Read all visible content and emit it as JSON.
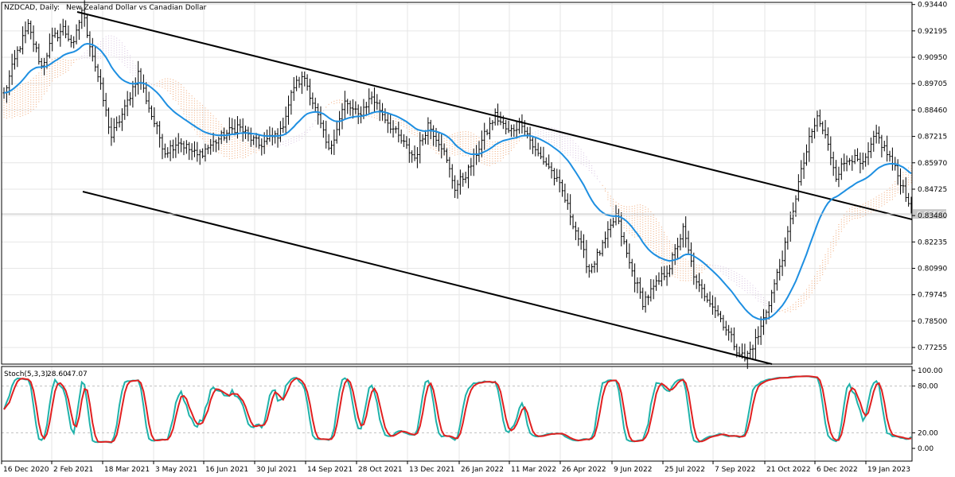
{
  "header": {
    "symbol": "NZDCAD, Daily:",
    "description": "New Zealand Dollar vs Canadian Dollar"
  },
  "stoch_header": {
    "label": "Stoch(5,3,3)",
    "main": "28.60",
    "signal": "47.07"
  },
  "colors": {
    "background": "#ffffff",
    "grid": "#e6e6e6",
    "bars": "#000000",
    "ma": "#1e8fe1",
    "cloud_bullish": "#f0a878",
    "cloud_bearish": "#d8c4e0",
    "channel": "#000000",
    "current_price_line": "#c0c0c0",
    "current_price_box": "#c8c8c8",
    "stoch_main": "#20b2aa",
    "stoch_signal": "#e02020",
    "stoch_levels": "#c0c0c0"
  },
  "chart_data": [
    {
      "type": "line",
      "panel": "price",
      "title": "NZDCAD, Daily: New Zealand Dollar vs Canadian Dollar",
      "x_labels": [
        "16 Dec 2020",
        "2 Feb 2021",
        "18 Mar 2021",
        "3 May 2021",
        "16 Jun 2021",
        "30 Jul 2021",
        "14 Sep 2021",
        "28 Oct 2021",
        "13 Dec 2021",
        "26 Jan 2022",
        "11 Mar 2022",
        "26 Apr 2022",
        "9 Jun 2022",
        "25 Jul 2022",
        "7 Sep 2022",
        "21 Oct 2022",
        "6 Dec 2022",
        "19 Jan 2023"
      ],
      "y_ticks": [
        "0.93440",
        "0.92195",
        "0.90950",
        "0.89705",
        "0.88460",
        "0.87215",
        "0.85970",
        "0.84725",
        "0.83480",
        "0.82235",
        "0.80990",
        "0.79745",
        "0.78500",
        "0.77255"
      ],
      "ylim": [
        0.7647,
        0.9354
      ],
      "current_price": "0.83556",
      "price_path": [
        [
          0,
          0.892
        ],
        [
          5,
          0.912
        ],
        [
          9,
          0.924
        ],
        [
          14,
          0.905
        ],
        [
          18,
          0.918
        ],
        [
          22,
          0.923
        ],
        [
          26,
          0.915
        ],
        [
          29,
          0.932
        ],
        [
          32,
          0.916
        ],
        [
          36,
          0.895
        ],
        [
          40,
          0.872
        ],
        [
          45,
          0.885
        ],
        [
          50,
          0.902
        ],
        [
          55,
          0.882
        ],
        [
          60,
          0.865
        ],
        [
          65,
          0.87
        ],
        [
          72,
          0.863
        ],
        [
          80,
          0.871
        ],
        [
          87,
          0.877
        ],
        [
          95,
          0.868
        ],
        [
          103,
          0.874
        ],
        [
          108,
          0.896
        ],
        [
          112,
          0.9
        ],
        [
          117,
          0.881
        ],
        [
          121,
          0.865
        ],
        [
          127,
          0.888
        ],
        [
          132,
          0.882
        ],
        [
          137,
          0.891
        ],
        [
          142,
          0.881
        ],
        [
          148,
          0.87
        ],
        [
          153,
          0.862
        ],
        [
          158,
          0.878
        ],
        [
          163,
          0.868
        ],
        [
          168,
          0.848
        ],
        [
          173,
          0.856
        ],
        [
          178,
          0.87
        ],
        [
          183,
          0.882
        ],
        [
          188,
          0.874
        ],
        [
          193,
          0.879
        ],
        [
          198,
          0.865
        ],
        [
          203,
          0.858
        ],
        [
          208,
          0.846
        ],
        [
          213,
          0.828
        ],
        [
          218,
          0.809
        ],
        [
          223,
          0.82
        ],
        [
          228,
          0.835
        ],
        [
          233,
          0.812
        ],
        [
          238,
          0.794
        ],
        [
          243,
          0.802
        ],
        [
          248,
          0.811
        ],
        [
          253,
          0.828
        ],
        [
          258,
          0.802
        ],
        [
          263,
          0.795
        ],
        [
          268,
          0.784
        ],
        [
          273,
          0.772
        ],
        [
          276,
          0.767
        ],
        [
          281,
          0.778
        ],
        [
          286,
          0.798
        ],
        [
          291,
          0.82
        ],
        [
          296,
          0.85
        ],
        [
          300,
          0.87
        ],
        [
          303,
          0.881
        ],
        [
          306,
          0.872
        ],
        [
          310,
          0.854
        ],
        [
          315,
          0.863
        ],
        [
          320,
          0.858
        ],
        [
          325,
          0.873
        ],
        [
          330,
          0.862
        ],
        [
          334,
          0.851
        ],
        [
          338,
          0.839
        ]
      ],
      "x_total": 338
    },
    {
      "type": "line",
      "panel": "stochastic",
      "title": "Stoch(5,3,3) 28.60 47.07",
      "y_ticks": [
        "100.00",
        "80.00",
        "20.00",
        "0.00"
      ],
      "ylim": [
        0,
        100
      ],
      "levels": [
        20,
        80
      ],
      "series": [
        {
          "name": "main",
          "value": 28.6
        },
        {
          "name": "signal",
          "value": 47.07
        }
      ]
    }
  ]
}
